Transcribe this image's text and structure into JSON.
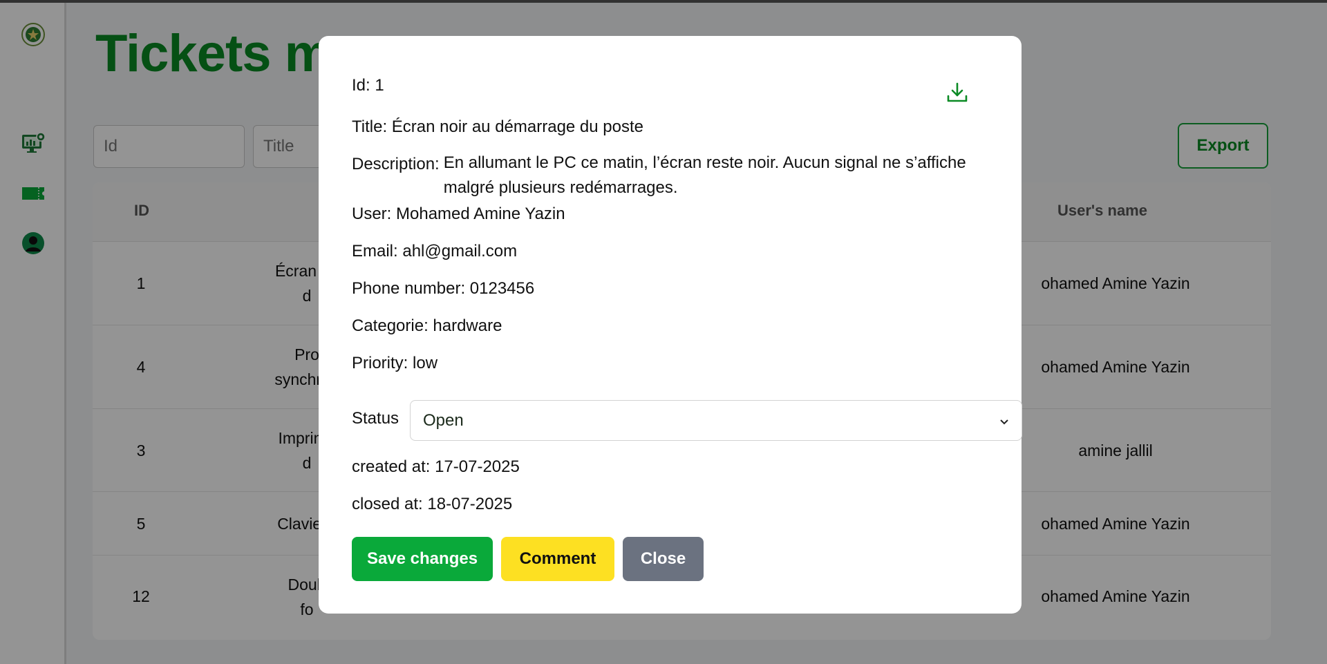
{
  "page": {
    "title": "Tickets m"
  },
  "sidebar": {
    "items": [
      {
        "icon": "logo-emblem-icon"
      },
      {
        "icon": "dashboard-monitor-icon"
      },
      {
        "icon": "ticket-icon"
      },
      {
        "icon": "user-profile-icon"
      }
    ]
  },
  "filters": {
    "id_placeholder": "Id",
    "title_placeholder": "Title"
  },
  "toolbar": {
    "export_label": "Export"
  },
  "table": {
    "headers": {
      "id": "ID",
      "user_name": "User's name"
    },
    "rows": [
      {
        "id": "1",
        "title_line1": "Écran no",
        "title_line2": "d",
        "user": "ohamed Amine Yazin"
      },
      {
        "id": "4",
        "title_line1": "Pro",
        "title_line2": "synchron",
        "user": "ohamed Amine Yazin"
      },
      {
        "id": "3",
        "title_line1": "Imprima",
        "title_line2": "d",
        "user": "amine jallil"
      },
      {
        "id": "5",
        "title_line1": "Clavier r",
        "title_line2": "",
        "user": "ohamed Amine Yazin"
      },
      {
        "id": "12",
        "title_line1": "Doub",
        "title_line2": "fo",
        "user": "ohamed Amine Yazin"
      }
    ]
  },
  "modal": {
    "id": "Id: 1",
    "title": "Title: Écran noir au démarrage du poste",
    "description_label": "Description:",
    "description_text": "En allumant le PC ce matin, l’écran reste noir. Aucun signal ne s’affiche malgré plusieurs redémarrages.",
    "user": "User: Mohamed Amine Yazin",
    "email": "Email: ahl@gmail.com",
    "phone": "Phone number: 0123456",
    "category": "Categorie: hardware",
    "priority": "Priority: low",
    "status_label": "Status",
    "status_value": "Open",
    "created_at": "created at: 17-07-2025",
    "closed_at": "closed at: 18-07-2025",
    "save_label": "Save changes",
    "comment_label": "Comment",
    "close_label": "Close"
  },
  "colors": {
    "brand_green": "#0a8a24",
    "save_button": "#0aa93a",
    "comment_button": "#fde022",
    "close_button": "#6b7280"
  }
}
